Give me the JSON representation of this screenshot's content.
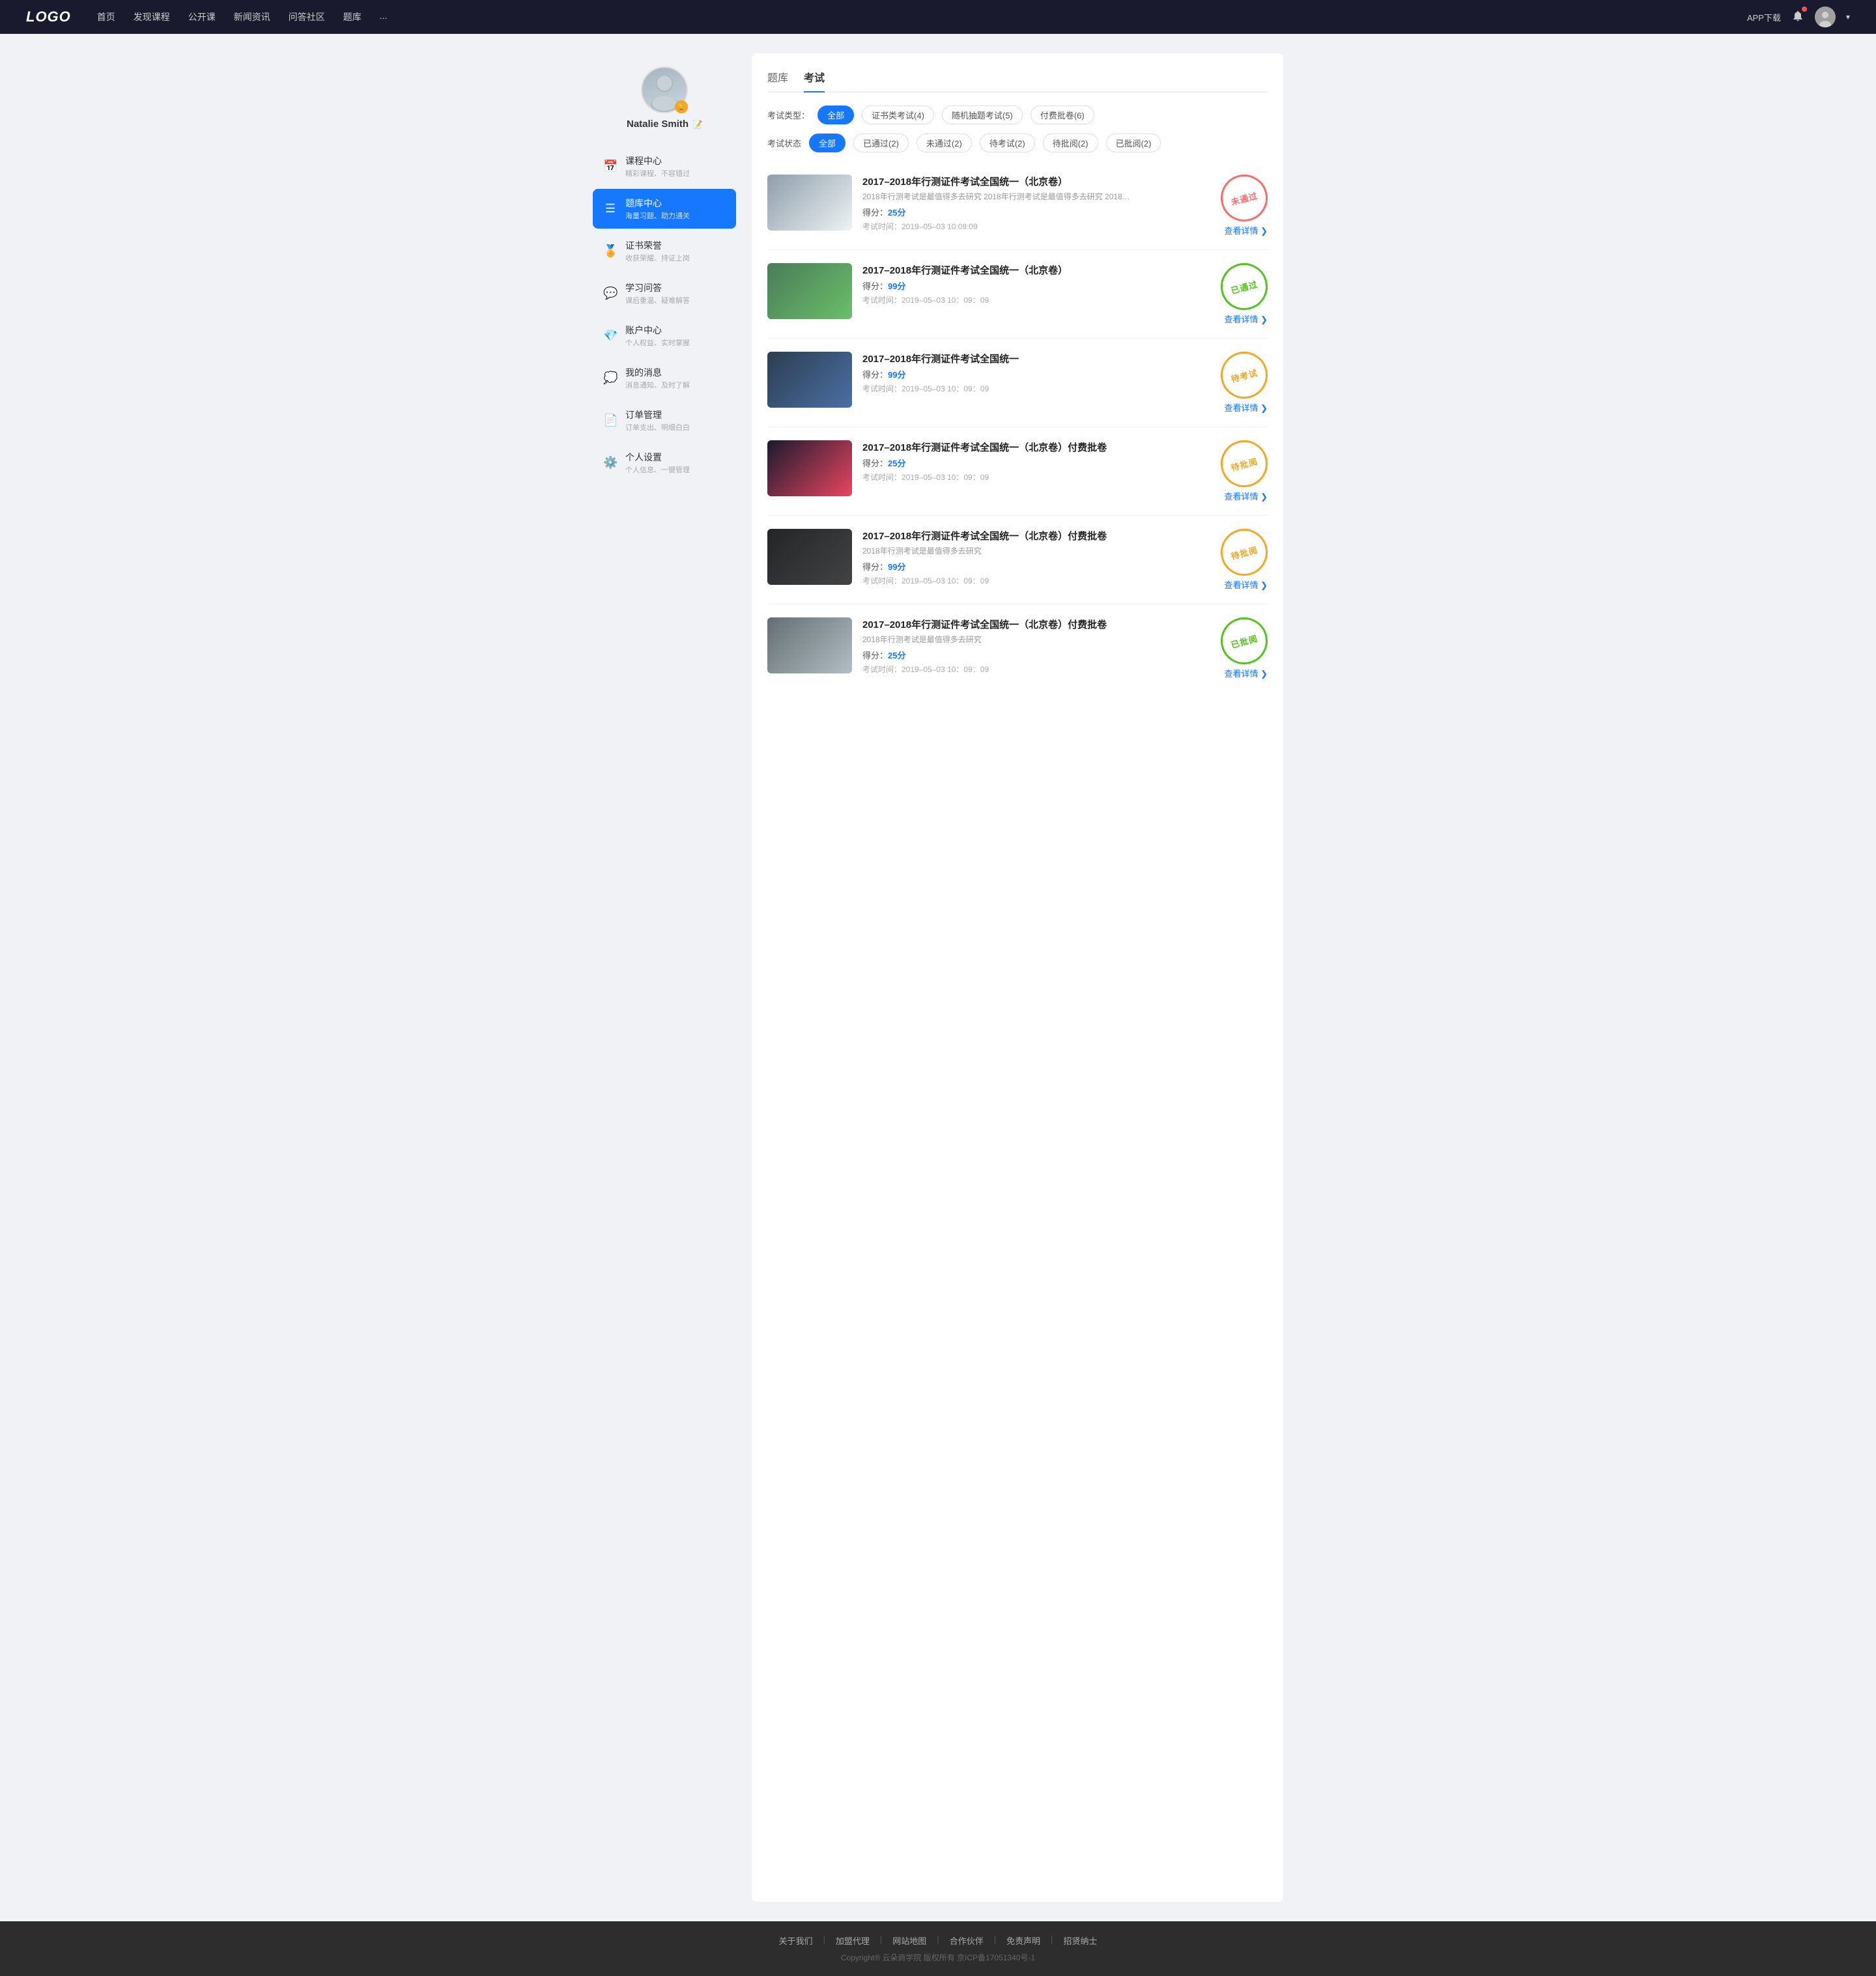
{
  "navbar": {
    "logo": "LOGO",
    "links": [
      "首页",
      "发现课程",
      "公开课",
      "新闻资讯",
      "问答社区",
      "题库",
      "..."
    ],
    "app_download": "APP下载",
    "user_menu_label": "用户菜单"
  },
  "sidebar": {
    "profile": {
      "name": "Natalie Smith",
      "edit_icon": "📝"
    },
    "menu_items": [
      {
        "id": "course-center",
        "icon": "📅",
        "title": "课程中心",
        "sub": "精彩课程、不容错过",
        "active": false
      },
      {
        "id": "question-bank",
        "icon": "☰",
        "title": "题库中心",
        "sub": "海量习题、助力通关",
        "active": true
      },
      {
        "id": "certificate",
        "icon": "🏅",
        "title": "证书荣誉",
        "sub": "收获荣耀、持证上岗",
        "active": false
      },
      {
        "id": "qa",
        "icon": "💬",
        "title": "学习问答",
        "sub": "课后重温、疑难解答",
        "active": false
      },
      {
        "id": "account",
        "icon": "💎",
        "title": "账户中心",
        "sub": "个人权益、实时掌握",
        "active": false
      },
      {
        "id": "messages",
        "icon": "💭",
        "title": "我的消息",
        "sub": "消息通知、及时了解",
        "active": false
      },
      {
        "id": "orders",
        "icon": "📄",
        "title": "订单管理",
        "sub": "订单支出、明细白白",
        "active": false
      },
      {
        "id": "settings",
        "icon": "⚙️",
        "title": "个人设置",
        "sub": "个人信息、一键管理",
        "active": false
      }
    ]
  },
  "content": {
    "tabs": [
      "题库",
      "考试"
    ],
    "active_tab": "考试",
    "type_filter": {
      "label": "考试类型：",
      "options": [
        "全部",
        "证书类考试(4)",
        "随机抽题考试(5)",
        "付费批卷(6)"
      ],
      "active": "全部"
    },
    "status_filter": {
      "label": "考试状态",
      "options": [
        "全部",
        "已通过(2)",
        "未通过(2)",
        "待考试(2)",
        "待批阅(2)",
        "已批阅(2)"
      ],
      "active": "全部"
    },
    "exams": [
      {
        "id": 1,
        "title": "2017–2018年行测证件考试全国统一（北京卷）",
        "desc": "2018年行测考试是最值得多去研究 2018年行测考试是最值得多去研究 2018年行...",
        "score_label": "得分：",
        "score": "25分",
        "time_label": "考试时间：",
        "time": "2019–05–03  10:09:09",
        "status": "未通过",
        "status_class": "not-passed",
        "thumb_class": "thumb-1",
        "detail_label": "查看详情"
      },
      {
        "id": 2,
        "title": "2017–2018年行测证件考试全国统一（北京卷）",
        "desc": "",
        "score_label": "得分：",
        "score": "99分",
        "time_label": "考试时间：",
        "time": "2019–05–03  10：09：09",
        "status": "已通过",
        "status_class": "passed",
        "thumb_class": "thumb-2",
        "detail_label": "查看详情"
      },
      {
        "id": 3,
        "title": "2017–2018年行测证件考试全国统一",
        "desc": "",
        "score_label": "得分：",
        "score": "99分",
        "time_label": "考试时间：",
        "time": "2019–05–03  10：09：09",
        "status": "待考试",
        "status_class": "pending",
        "thumb_class": "thumb-3",
        "detail_label": "查看详情"
      },
      {
        "id": 4,
        "title": "2017–2018年行测证件考试全国统一（北京卷）付费批卷",
        "desc": "",
        "score_label": "得分：",
        "score": "25分",
        "time_label": "考试时间：",
        "time": "2019–05–03  10：09：09",
        "status": "待批阅",
        "status_class": "pending-review",
        "thumb_class": "thumb-4",
        "detail_label": "查看详情"
      },
      {
        "id": 5,
        "title": "2017–2018年行测证件考试全国统一（北京卷）付费批卷",
        "desc": "2018年行测考试是最值得多去研究",
        "score_label": "得分：",
        "score": "99分",
        "time_label": "考试时间：",
        "time": "2019–05–03  10：09：09",
        "status": "待批阅",
        "status_class": "pending-review",
        "thumb_class": "thumb-5",
        "detail_label": "查看详情"
      },
      {
        "id": 6,
        "title": "2017–2018年行测证件考试全国统一（北京卷）付费批卷",
        "desc": "2018年行测考试是最值得多去研究",
        "score_label": "得分：",
        "score": "25分",
        "time_label": "考试时间：",
        "time": "2019–05–03  10：09：09",
        "status": "已批阅",
        "status_class": "reviewed",
        "thumb_class": "thumb-6",
        "detail_label": "查看详情"
      }
    ]
  },
  "footer": {
    "links": [
      "关于我们",
      "加盟代理",
      "网站地图",
      "合作伙伴",
      "免责声明",
      "招贤纳士"
    ],
    "copyright": "Copyright® 云朵商学院  版权所有    京ICP备17051340号-1"
  }
}
